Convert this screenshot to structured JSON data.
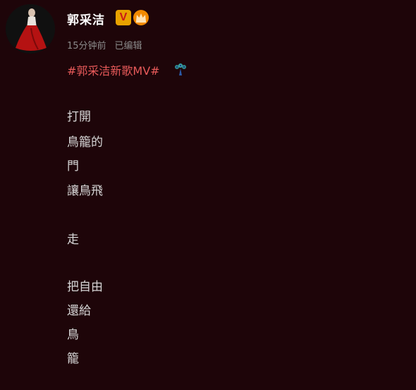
{
  "post": {
    "author": {
      "name": "郭采洁"
    },
    "badges": {
      "verified_label": "V",
      "verified_icon": "verified-v-icon",
      "member_icon": "crown-member-icon"
    },
    "meta": {
      "time": "15分钟前",
      "edited": "已编辑"
    },
    "topic": {
      "text": "#郭采洁新歌MV#",
      "emoji_icon": "peacock-icon"
    },
    "lines": [
      "打開",
      "鳥籠的",
      "門",
      "讓鳥飛",
      "走",
      "把自由",
      "還給",
      "鳥",
      "籠"
    ]
  },
  "colors": {
    "background": "#1e0509",
    "topic": "#e85a5a",
    "meta": "#8a8a8a",
    "text": "#d6d6d6",
    "username": "#ffffff"
  }
}
